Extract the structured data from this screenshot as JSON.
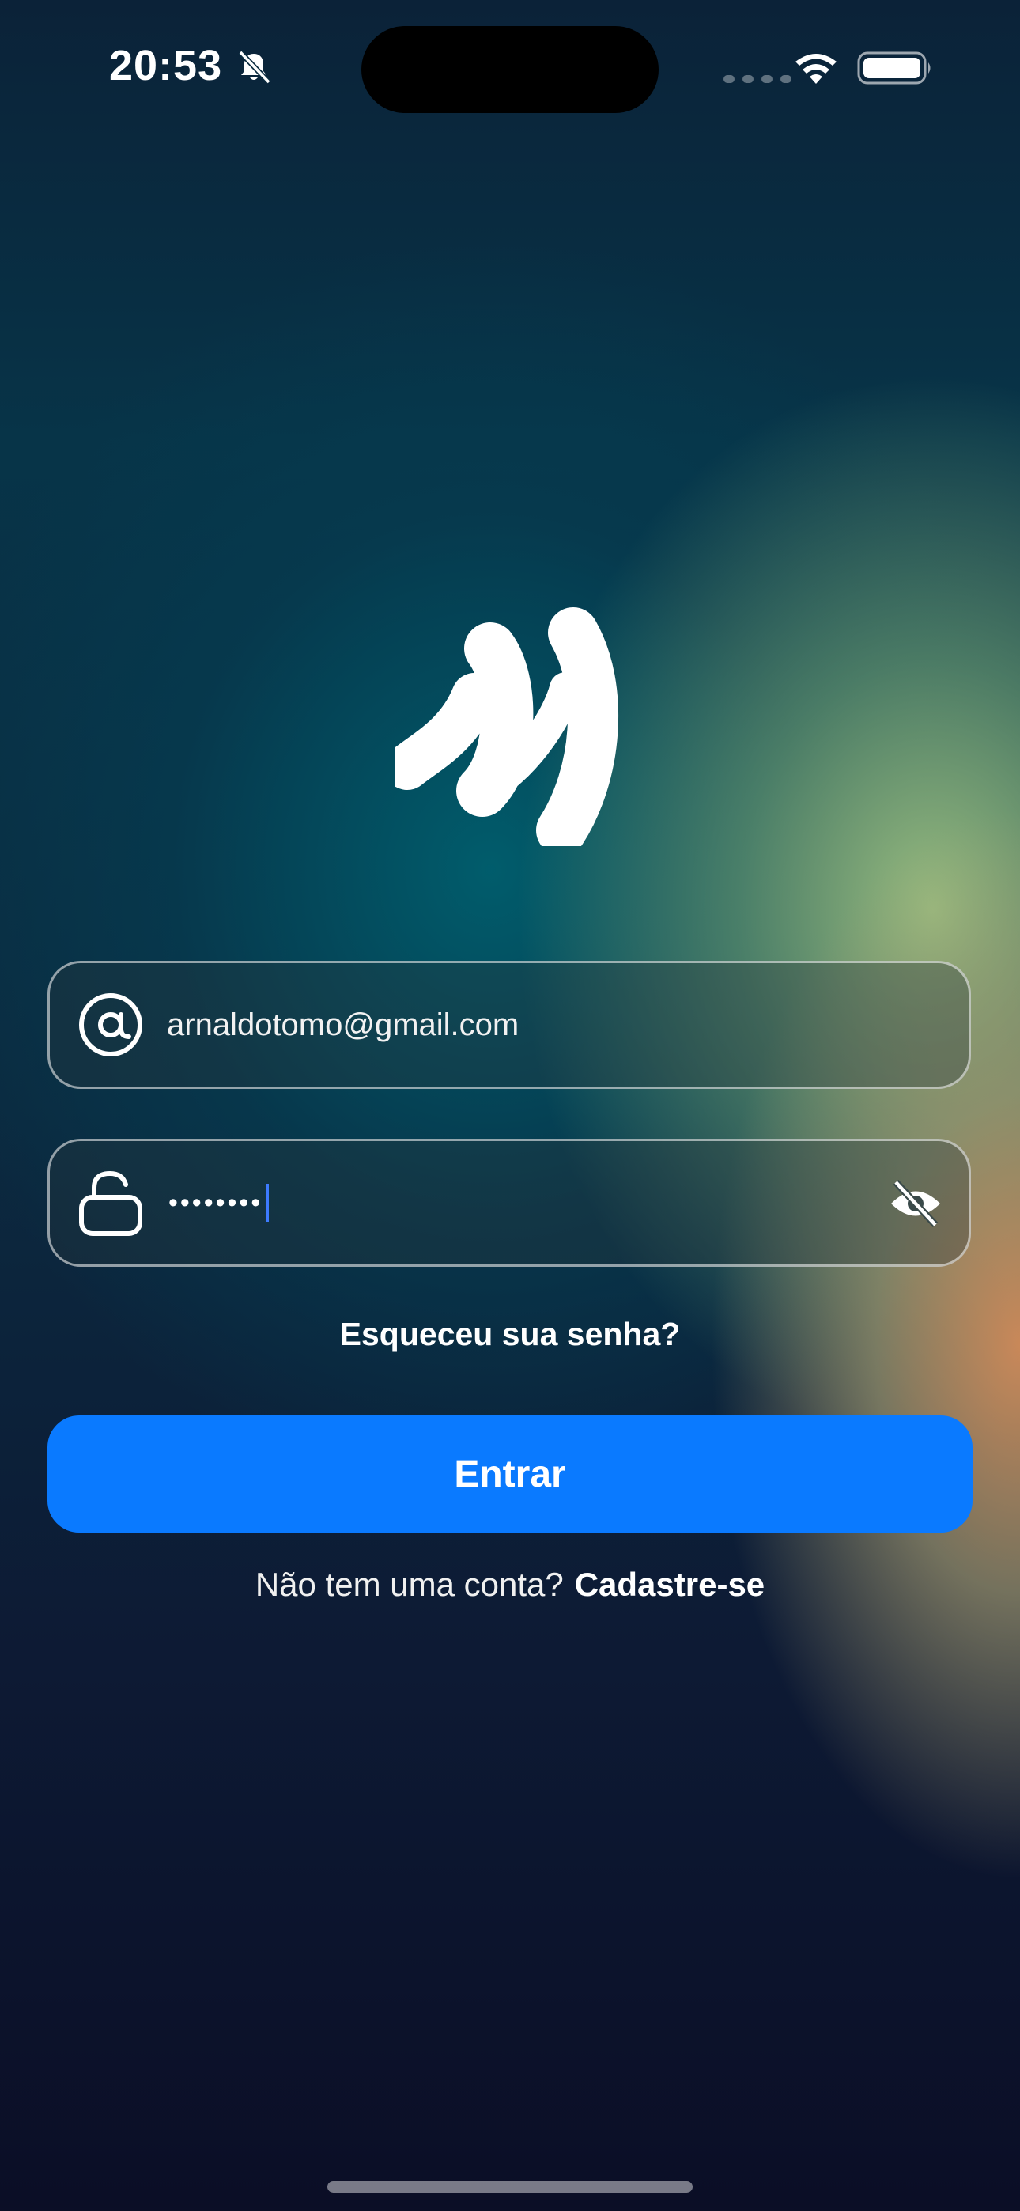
{
  "status_bar": {
    "time": "20:53",
    "icons": [
      "bell-slash-icon",
      "cellular-dots-icon",
      "wifi-icon",
      "battery-icon"
    ]
  },
  "logo": {
    "icon": "brand-logo-icon"
  },
  "email_field": {
    "icon": "at-sign-icon",
    "value": "arnaldotomo@gmail.com"
  },
  "password_field": {
    "icon": "unlock-icon",
    "masked_value": "••••••••",
    "visibility_icon": "eye-slash-icon"
  },
  "forgot_password": {
    "label": "Esqueceu sua senha?"
  },
  "login_button": {
    "label": "Entrar",
    "color": "#0a7aff"
  },
  "signup": {
    "prompt": "Não tem uma conta?",
    "link_label": "Cadastre-se"
  }
}
